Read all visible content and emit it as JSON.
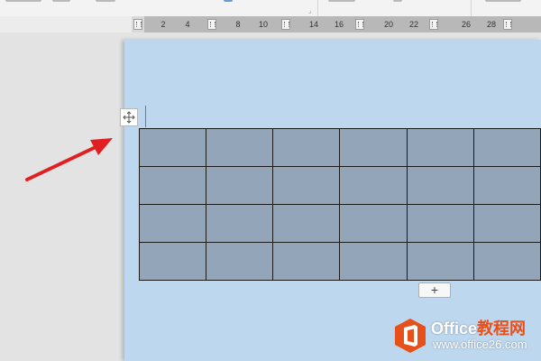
{
  "ruler": {
    "ticks": [
      "2",
      "4",
      "8",
      "10",
      "14",
      "16",
      "20",
      "22",
      "26",
      "28"
    ]
  },
  "table": {
    "rows": 4,
    "columns": 6
  },
  "buttons": {
    "add_row_label": "+"
  },
  "icons": {
    "move": "move-icon",
    "arrow": "red-arrow"
  },
  "colors": {
    "page": "#bdd7ee",
    "cells": "#93a6b9",
    "arrow": "#e02020",
    "brand": "#e8501a"
  },
  "watermark": {
    "title_white": "Office",
    "title_orange": "教程网",
    "url": "www.office26.com"
  }
}
